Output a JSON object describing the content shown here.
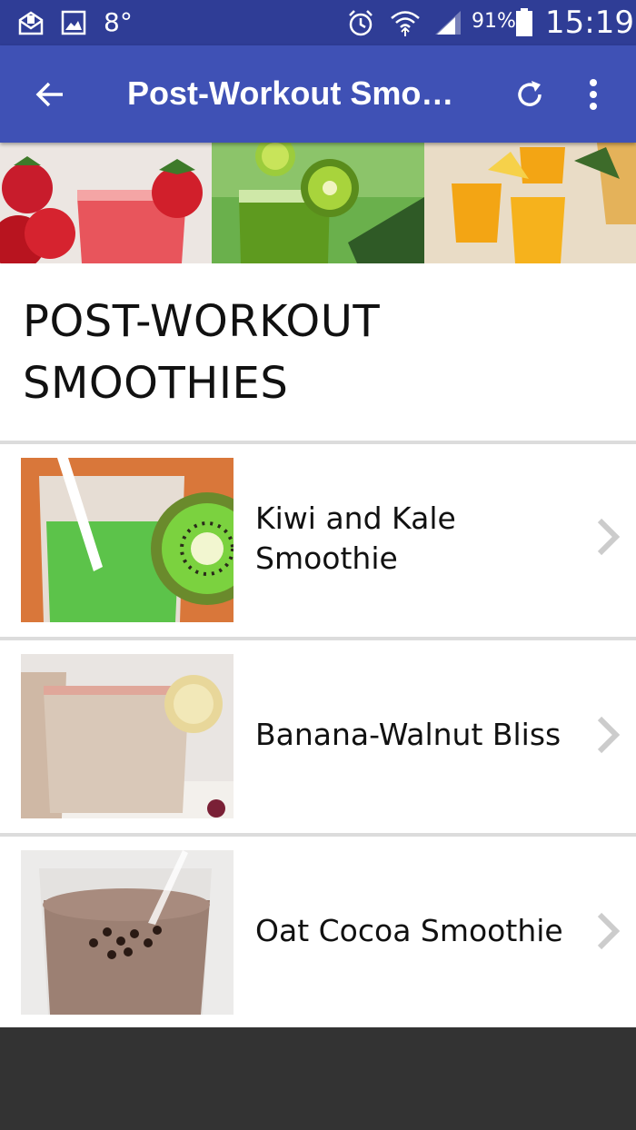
{
  "status_bar": {
    "temperature": "8°",
    "battery_percent": "91%",
    "time": "15:19",
    "icons": [
      "email-icon",
      "gallery-icon",
      "alarm-icon",
      "wifi-icon",
      "signal-icon",
      "battery-icon"
    ]
  },
  "app_bar": {
    "title": "Post-Workout Smoo…",
    "back_icon": "back-arrow-icon",
    "refresh_icon": "refresh-icon",
    "menu_icon": "more-vert-icon"
  },
  "page": {
    "heading_line1": "POST-WORKOUT",
    "heading_line2": "SMOOTHIES"
  },
  "items": [
    {
      "label_line1": "Kiwi and Kale",
      "label_line2": "Smoothie"
    },
    {
      "label": "Banana-Walnut Bliss"
    },
    {
      "label": "Oat Cocoa Smoothie"
    }
  ],
  "colors": {
    "status_bar": "#2f3d96",
    "app_bar": "#3f51b5",
    "divider": "#dcdcdc",
    "bottom_bar": "#333333"
  }
}
